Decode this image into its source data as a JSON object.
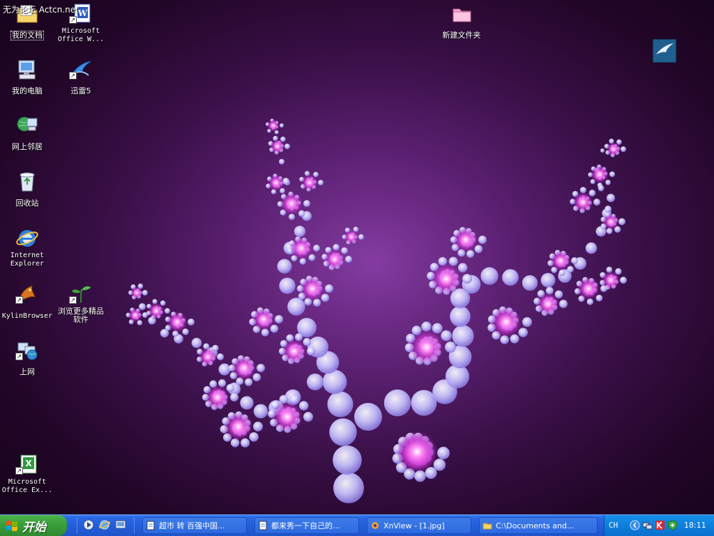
{
  "watermark": "无为论坛 Actcn.net",
  "desktop": {
    "icons": [
      {
        "label": "我的文档"
      },
      {
        "label": "Microsoft Office W..."
      },
      {
        "label": "新建文件夹"
      },
      {
        "label": "我的电脑"
      },
      {
        "label": "迅雷5"
      },
      {
        "label": "网上邻居"
      },
      {
        "label": "回收站"
      },
      {
        "label": "Internet Explorer"
      },
      {
        "label": "KylinBrowser"
      },
      {
        "label": "浏览更多精品软件"
      },
      {
        "label": "上网"
      },
      {
        "label": "Microsoft Office Ex..."
      }
    ],
    "wallpaper_colors": {
      "bg_center": "#7a2f92",
      "bg_edge": "#14031a",
      "bead": "#b9b2ff",
      "glow": "#ff66f0"
    }
  },
  "taskbar": {
    "start_label": "开始",
    "tasks": [
      {
        "label": "超市 转 百强中国...",
        "icon": "document-icon"
      },
      {
        "label": "都来秀一下自己的...",
        "icon": "document-icon"
      },
      {
        "label": "XnView - [1.jpg]",
        "icon": "xnview-icon"
      },
      {
        "label": "C:\\Documents and...",
        "icon": "folder-icon"
      }
    ],
    "tray": {
      "language": "CH",
      "clock": "18:11"
    }
  }
}
